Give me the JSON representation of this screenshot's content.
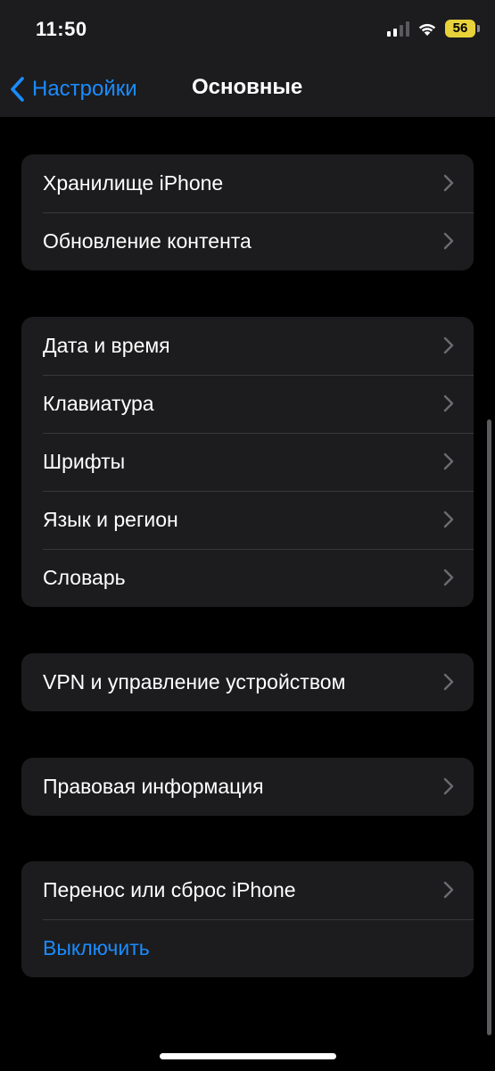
{
  "status_bar": {
    "time": "11:50",
    "battery": "56",
    "battery_color": "#e8d23a",
    "icons": [
      "signal-icon",
      "wifi-icon",
      "battery-icon"
    ]
  },
  "nav": {
    "back_label": "Настройки",
    "title": "Основные",
    "back_icon": "chevron-left-icon",
    "accent_color": "#1a8cff"
  },
  "groups": [
    {
      "rows": [
        {
          "label": "Хранилище iPhone"
        },
        {
          "label": "Обновление контента"
        }
      ]
    },
    {
      "rows": [
        {
          "label": "Дата и время"
        },
        {
          "label": "Клавиатура"
        },
        {
          "label": "Шрифты"
        },
        {
          "label": "Язык и регион"
        },
        {
          "label": "Словарь"
        }
      ]
    },
    {
      "rows": [
        {
          "label": "VPN и управление устройством"
        }
      ]
    },
    {
      "rows": [
        {
          "label": "Правовая информация"
        }
      ]
    },
    {
      "rows": [
        {
          "label": "Перенос или сброс iPhone"
        },
        {
          "label": "Выключить"
        }
      ]
    }
  ]
}
